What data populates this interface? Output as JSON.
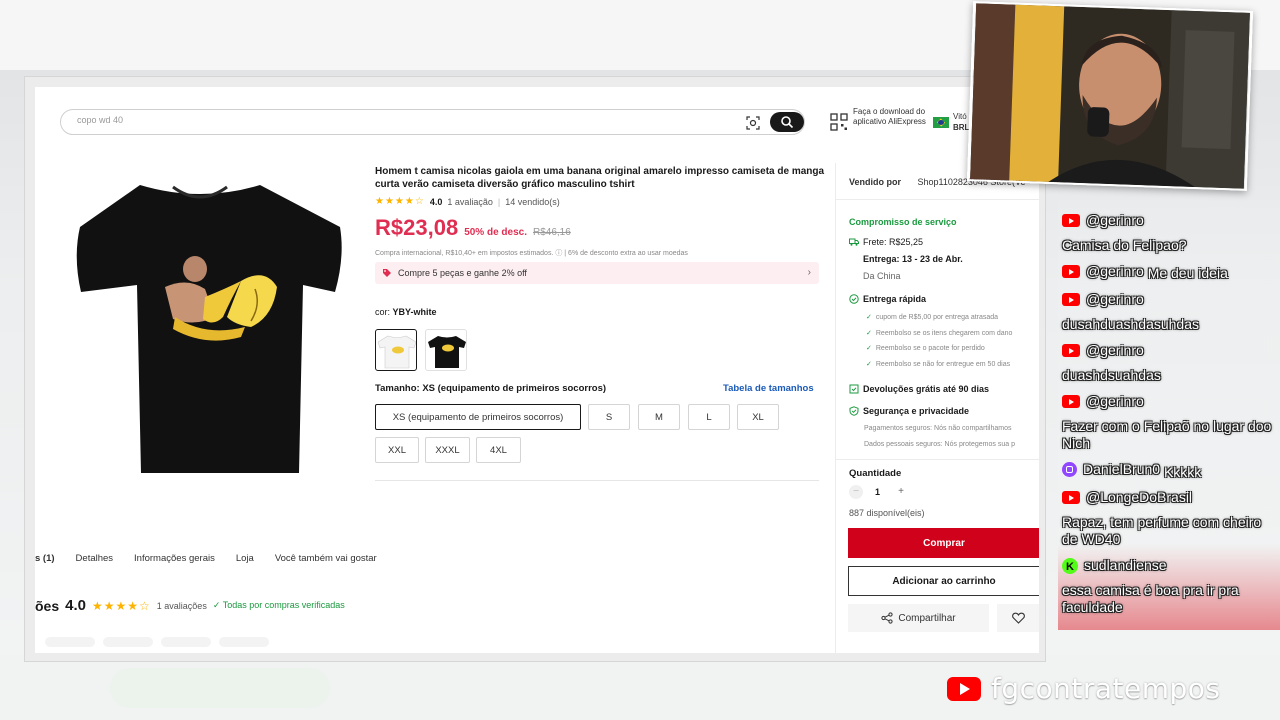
{
  "search": {
    "placeholder": "copo wd 40"
  },
  "header": {
    "app_download": "Faça o download do aplicativo AliExpress",
    "locale_name": "Vitó",
    "currency": "BRL"
  },
  "product": {
    "title": "Homem t camisa nicolas gaiola em uma banana original amarelo impresso camiseta de manga curta verão camiseta diversão gráfico masculino tshirt",
    "stars": "★★★★☆",
    "rating": "4.0",
    "reviews": "1 avaliação",
    "sold": "14 vendido(s)",
    "price": "R$23,08",
    "discount": "50% de desc.",
    "old_price": "R$46,16",
    "tax_note": "Compra internacional, R$10,40+ em impostos estimados. ⓘ | 6% de desconto extra ao usar moedas",
    "promo": "Compre 5 peças e ganhe 2% off",
    "color_label": "cor:",
    "color_value": "YBY-white",
    "size_label": "Tamanho: XS (equipamento de primeiros socorros)",
    "size_table_link": "Tabela de tamanhos",
    "sizes": [
      "XS (equipamento de primeiros socorros)",
      "S",
      "M",
      "L",
      "XL",
      "XXL",
      "XXXL",
      "4XL"
    ]
  },
  "tabs": [
    "s (1)",
    "Detalhes",
    "Informações gerais",
    "Loja",
    "Você também vai gostar"
  ],
  "reviews_section": {
    "heading": "ões",
    "score": "4.0",
    "stars": "★★★★☆",
    "count": "1 avaliações",
    "verified": "✓ Todas por compras verificadas"
  },
  "side": {
    "sold_by_label": "Vendido por",
    "store": "Shop1102823046 Store(Ve",
    "service_title": "Compromisso de serviço",
    "shipping_label": "Frete: R$25,25",
    "delivery": "Entrega: 13 - 23 de Abr.",
    "origin": "Da China",
    "fast_delivery": "Entrega rápida",
    "checks": [
      "cupom de R$5,00 por entrega atrasada",
      "Reembolso se os itens chegarem com dano",
      "Reembolso se o pacote for perdido",
      "Reembolso se não for entregue em 50 dias"
    ],
    "returns": "Devoluções grátis até 90 dias",
    "security": "Segurança e privacidade",
    "security_1": "Pagamentos seguros: Nós não compartilhamos",
    "security_2": "Dados pessoais seguros: Nós protegemos sua p",
    "qty_label": "Quantidade",
    "qty_minus": "−",
    "qty": "1",
    "qty_plus": "+",
    "stock": "887 disponível(eis)",
    "buy": "Comprar",
    "cart": "Adicionar ao carrinho",
    "share": "Compartilhar"
  },
  "chat": [
    {
      "platform": "youtube",
      "user": "@gerinro",
      "msg": "Camisa do Felipao?"
    },
    {
      "platform": "youtube",
      "user": "@gerinro",
      "msg": "Me deu ideia"
    },
    {
      "platform": "youtube",
      "user": "@gerinro",
      "msg": "dusahduashdasuhdas"
    },
    {
      "platform": "youtube",
      "user": "@gerinro",
      "msg": "duashdsuahdas"
    },
    {
      "platform": "youtube",
      "user": "@gerinro",
      "msg": "Fazer com o Felipaõ no lugar doo Nich"
    },
    {
      "platform": "twitch",
      "user": "DanielBrun0",
      "msg": "Kkkkk"
    },
    {
      "platform": "youtube",
      "user": "@LongeDoBrasil",
      "msg": "Rapaz, tem perfume com cheiro de WD40"
    },
    {
      "platform": "kick",
      "user": "sudlandiense",
      "msg": "essa camisa é boa pra ir pra faculdade"
    }
  ],
  "brand": {
    "name": "fgcontratempos"
  },
  "colors": {
    "price": "#e02e52",
    "buy": "#d0021b",
    "link": "#1a5ab8",
    "verified": "#1a9a3f"
  }
}
